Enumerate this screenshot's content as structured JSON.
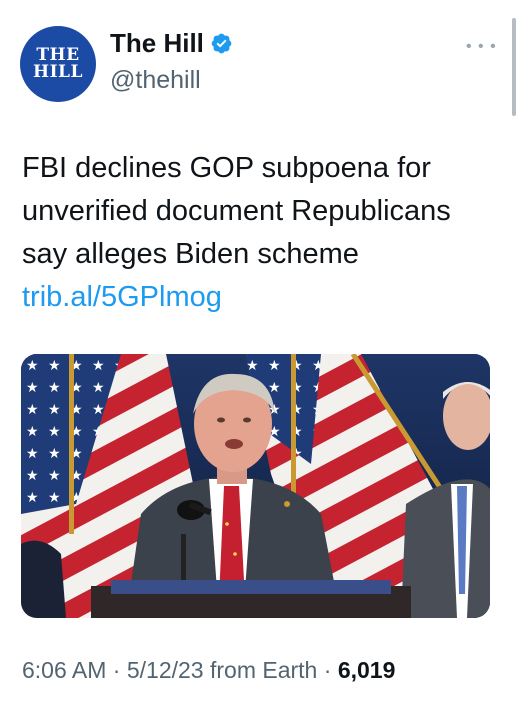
{
  "account": {
    "avatar_text": "THE\nHILL",
    "display_name": "The Hill",
    "handle": "@thehill",
    "verified": true
  },
  "tweet": {
    "text": "FBI declines GOP subpoena for unverified document Republicans say alleges Biden scheme ",
    "link_text": "trib.al/5GPlmog"
  },
  "meta": {
    "time": "6:06 AM",
    "separator1": " · ",
    "date": "5/12/23",
    "source": " from Earth",
    "separator2": " · ",
    "views": "6,019"
  },
  "icons": {
    "verified": "verified-badge-icon",
    "more": "more-options-icon"
  },
  "colors": {
    "link": "#1d9bf0",
    "verified": "#1d9bf0",
    "secondary_text": "#536471",
    "avatar_bg": "#1b4ba5"
  }
}
